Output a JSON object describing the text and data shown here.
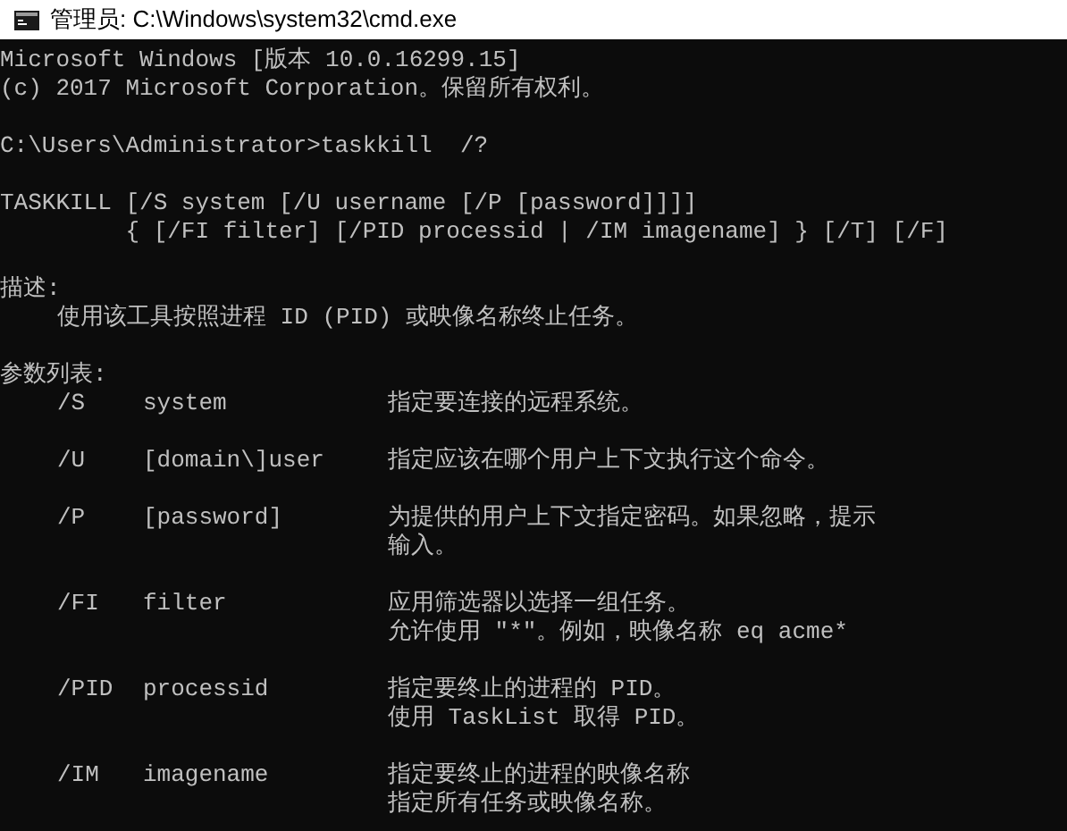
{
  "window": {
    "title": "管理员: C:\\Windows\\system32\\cmd.exe"
  },
  "console": {
    "banner": [
      "Microsoft Windows [版本 10.0.16299.15]",
      "(c) 2017 Microsoft Corporation。保留所有权利。"
    ],
    "command": "C:\\Users\\Administrator>taskkill  /?",
    "syntax": [
      "TASKKILL [/S system [/U username [/P [password]]]]",
      "         { [/FI filter] [/PID processid | /IM imagename] } [/T] [/F]"
    ],
    "description_heading": "描述:",
    "description": "使用该工具按照进程 ID (PID) 或映像名称终止任务。",
    "parameters_heading": "参数列表:",
    "parameters": [
      {
        "switch": "/S",
        "value": "system",
        "description": [
          "指定要连接的远程系统。"
        ]
      },
      {
        "switch": "/U",
        "value": "[domain\\]user",
        "description": [
          "指定应该在哪个用户上下文执行这个命令。"
        ]
      },
      {
        "switch": "/P",
        "value": "[password]",
        "description": [
          "为提供的用户上下文指定密码。如果忽略，提示",
          "输入。"
        ]
      },
      {
        "switch": "/FI",
        "value": "filter",
        "description": [
          "应用筛选器以选择一组任务。",
          "允许使用 \"*\"。例如，映像名称 eq acme*"
        ]
      },
      {
        "switch": "/PID",
        "value": "processid",
        "description": [
          "指定要终止的进程的 PID。",
          "使用 TaskList 取得 PID。"
        ]
      },
      {
        "switch": "/IM",
        "value": "imagename",
        "description": [
          "指定要终止的进程的映像名称",
          "指定所有任务或映像名称。"
        ]
      }
    ]
  }
}
